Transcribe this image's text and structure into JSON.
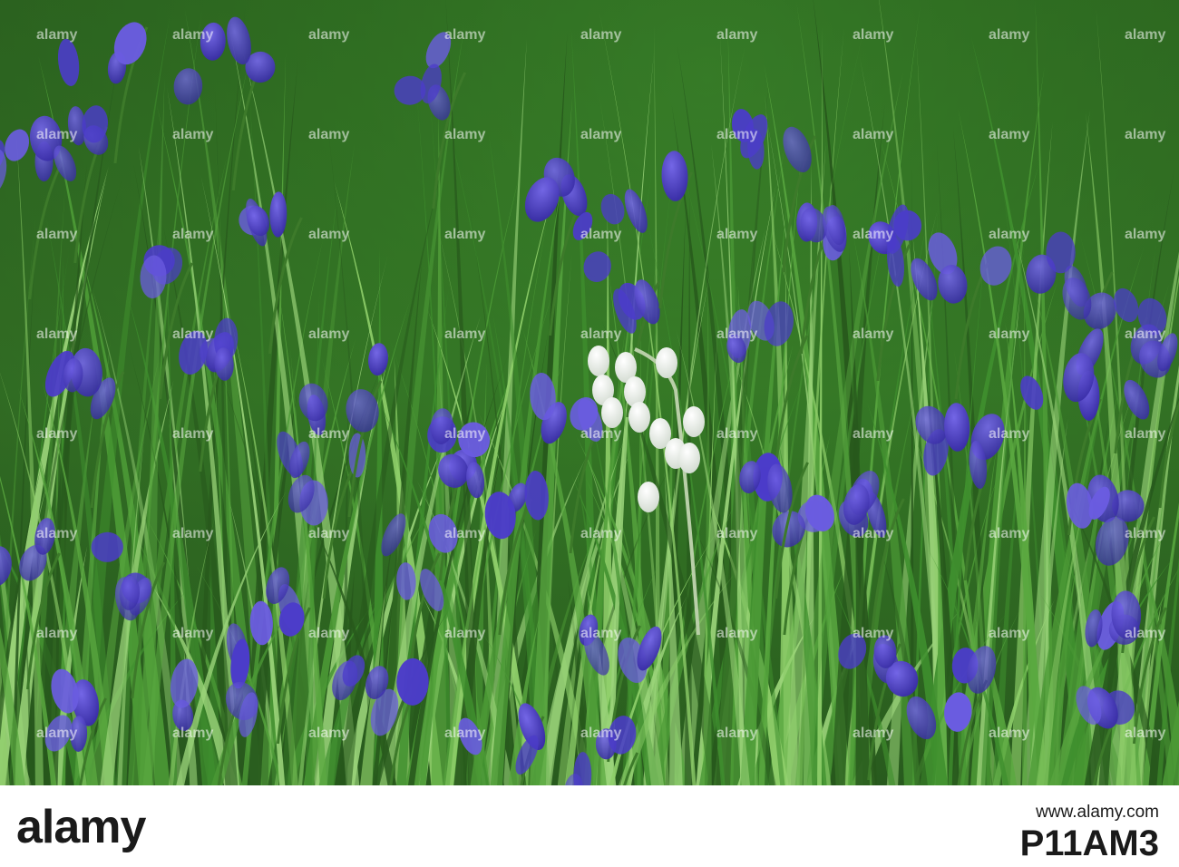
{
  "photo": {
    "subject": "bluebell",
    "colors": {
      "grass_dark": "#27581c",
      "grass_mid": "#3f8f2e",
      "grass_light": "#8fcf6a",
      "bluebell": "#4b3cc9",
      "bluebell_light": "#6a5ce0",
      "white_bell": "#f2f4f0"
    }
  },
  "footer": {
    "brand": "alamy",
    "url": "www.alamy.com",
    "image_code": "P11AM3"
  }
}
